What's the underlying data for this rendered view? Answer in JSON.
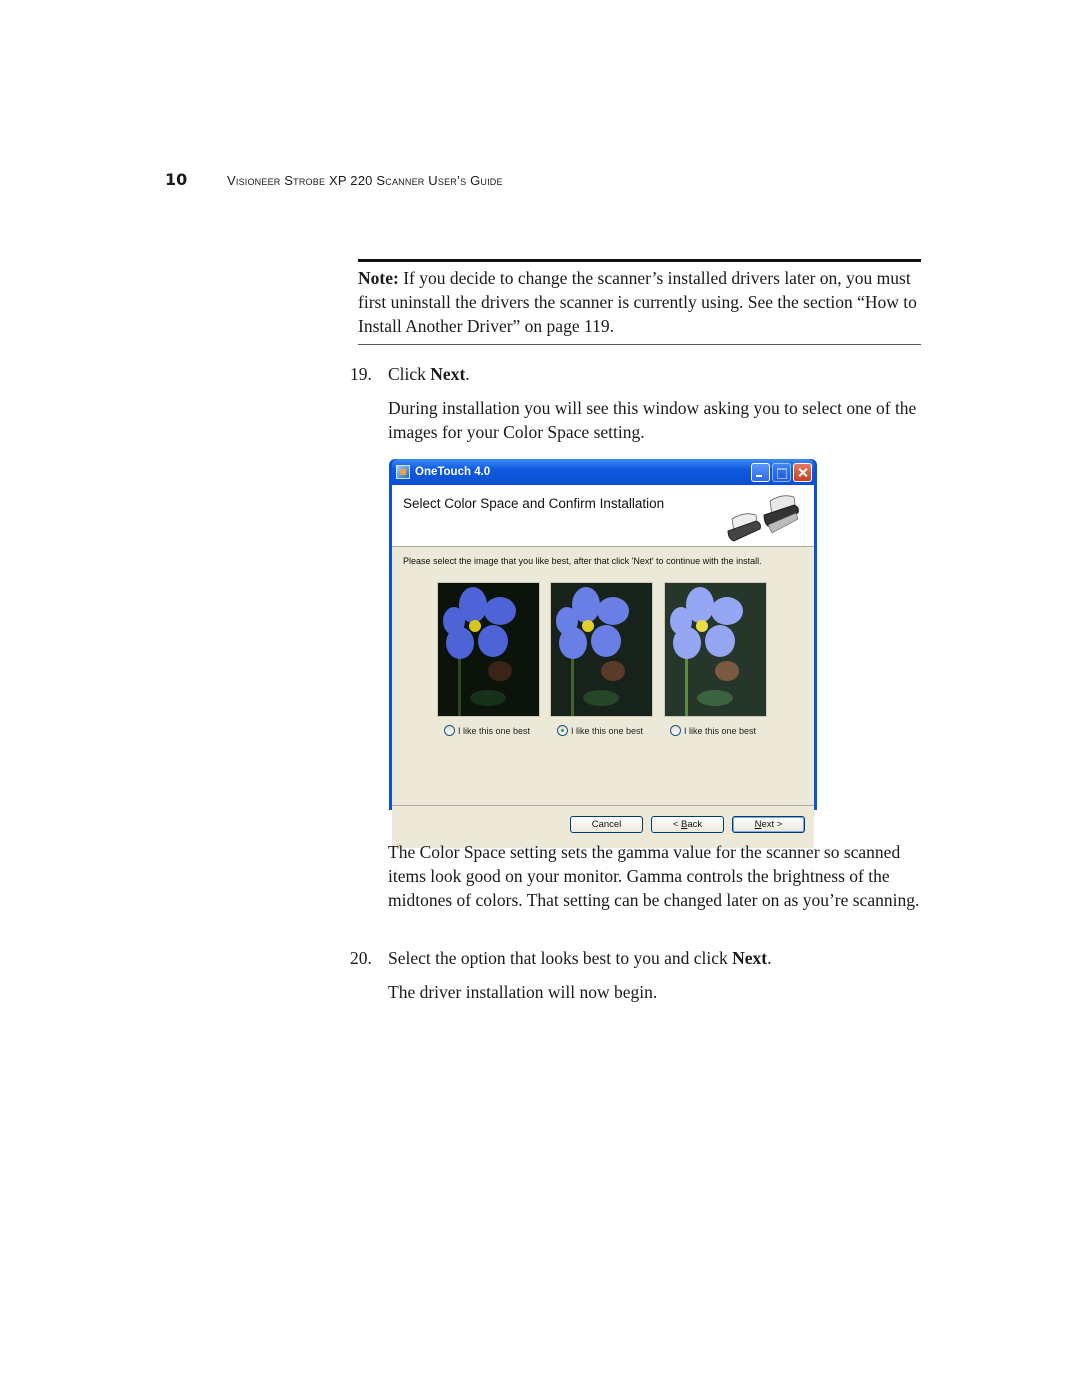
{
  "running_head": {
    "page_number": "10",
    "title": "Visioneer Strobe XP 220 Scanner User’s Guide"
  },
  "note": {
    "label": "Note:",
    "text": " If you decide to change the scanner’s installed drivers later on, you must first uninstall the drivers the scanner is currently using. See the section “How to Install Another Driver” on page 119."
  },
  "step19": {
    "number": "19.",
    "prefix": "Click ",
    "bold": "Next",
    "suffix": ".",
    "description": "During installation you will see this window asking you to select one of the images for your Color Space setting."
  },
  "dialog": {
    "window_title": "OneTouch 4.0",
    "header_title": "Select Color Space and Confirm Installation",
    "instruction": "Please select the image that you like best, after that click 'Next' to continue with the install.",
    "options": [
      {
        "label": "I like this one best",
        "selected": false
      },
      {
        "label": "I like this one best",
        "selected": true
      },
      {
        "label": "I like this one best",
        "selected": false
      }
    ],
    "buttons": {
      "cancel": "Cancel",
      "back_prefix": "< ",
      "back_mnemonic": "B",
      "back_rest": "ack",
      "next_mnemonic": "N",
      "next_rest": "ext >"
    }
  },
  "explanation": "The Color Space setting sets the gamma value for the scanner so scanned items look good on your monitor. Gamma controls the brightness of the midtones of colors. That setting can be changed later on as you’re scanning.",
  "step20": {
    "number": "20.",
    "prefix": "Select the option that looks best to you and click ",
    "bold": "Next",
    "suffix": ".",
    "description": "The driver installation will now begin."
  }
}
